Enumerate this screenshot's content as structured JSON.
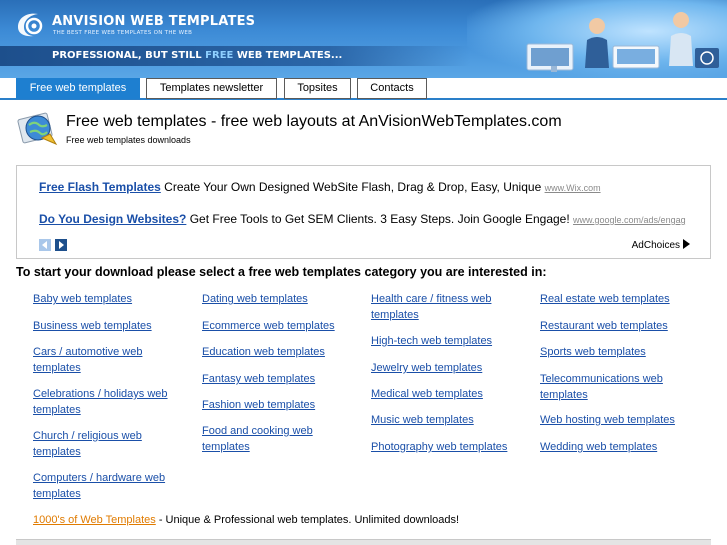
{
  "header": {
    "brand": "ANVISION WEB TEMPLATES",
    "tagline": "THE BEST FREE WEB TEMPLATES ON THE WEB",
    "slogan_before": "PROFESSIONAL, BUT STILL ",
    "slogan_free": "FREE",
    "slogan_after": " WEB TEMPLATES...",
    "colors": {
      "banner": "#3d8bd6",
      "nav_active": "#1e7fd0",
      "link": "#1a4fa8",
      "promo": "#e07b00"
    }
  },
  "nav": {
    "tabs": [
      {
        "label": "Free web templates",
        "active": true
      },
      {
        "label": "Templates newsletter",
        "active": false
      },
      {
        "label": "Topsites",
        "active": false
      },
      {
        "label": "Contacts",
        "active": false
      }
    ]
  },
  "page": {
    "title": "Free web templates - free web layouts at AnVisionWebTemplates.com",
    "subtitle": "Free web templates downloads"
  },
  "ads": {
    "items": [
      {
        "link": "Free Flash Templates",
        "text": " Create Your Own Designed WebSite Flash, Drag & Drop, Easy, Unique ",
        "url": "www.Wix.com"
      },
      {
        "link": "Do You Design Websites?",
        "text": " Get Free Tools to Get SEM Clients. 3 Easy Steps. Join Google Engage! ",
        "url": "www.google.com/ads/engag"
      }
    ],
    "adchoices": "AdChoices"
  },
  "categories": {
    "heading": "To start your download please select a free web templates category you are interested in:",
    "columns": [
      [
        "Baby web templates",
        "Business web templates",
        "Cars / automotive web templates",
        "Celebrations / holidays web templates",
        "Church / religious web templates",
        "Computers / hardware web templates"
      ],
      [
        "Dating web templates",
        "Ecommerce web templates",
        "Education web templates",
        "Fantasy web templates",
        "Fashion web templates",
        "Food and cooking web templates"
      ],
      [
        "Health care / fitness web templates",
        "High-tech web templates",
        "Jewelry web templates",
        "Medical web templates",
        "Music web templates",
        "Photography web templates"
      ],
      [
        "Real estate web templates",
        "Restaurant web templates",
        "Sports web templates",
        "Telecommunications web templates",
        "Web hosting web templates",
        "Wedding web templates"
      ]
    ]
  },
  "footer": {
    "promo_link": "1000's of Web Templates",
    "promo_text": " - Unique & Professional web templates. Unlimited downloads!"
  }
}
